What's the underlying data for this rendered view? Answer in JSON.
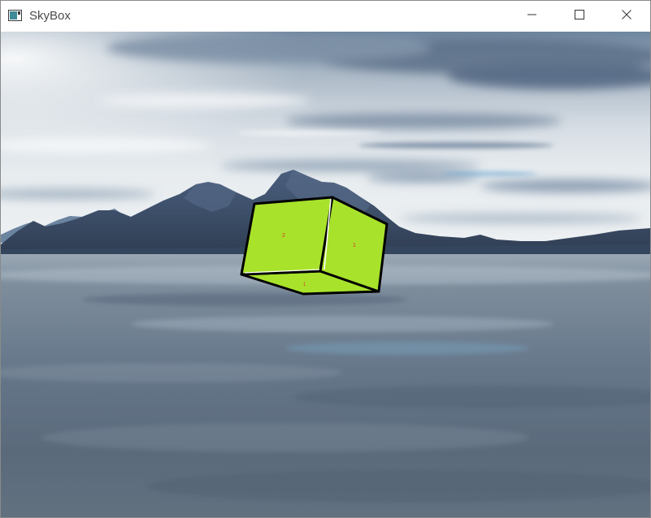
{
  "window": {
    "title": "SkyBox",
    "icon": "app-window-icon",
    "controls": {
      "minimize": "minimize-icon",
      "maximize": "maximize-icon",
      "close": "close-icon"
    }
  },
  "scene": {
    "background": "skybox-lake-mountains",
    "cube": {
      "color": "#a8e22b",
      "edge_color": "#000000",
      "face_labels": [
        "2",
        "1",
        "1"
      ],
      "label_color": "#d83a2a"
    },
    "colors": {
      "sky_top": "#6f8aa6",
      "sky_mid": "#c9d3dc",
      "mountains": "#3d4f6b",
      "water": "#5c6e82"
    }
  }
}
